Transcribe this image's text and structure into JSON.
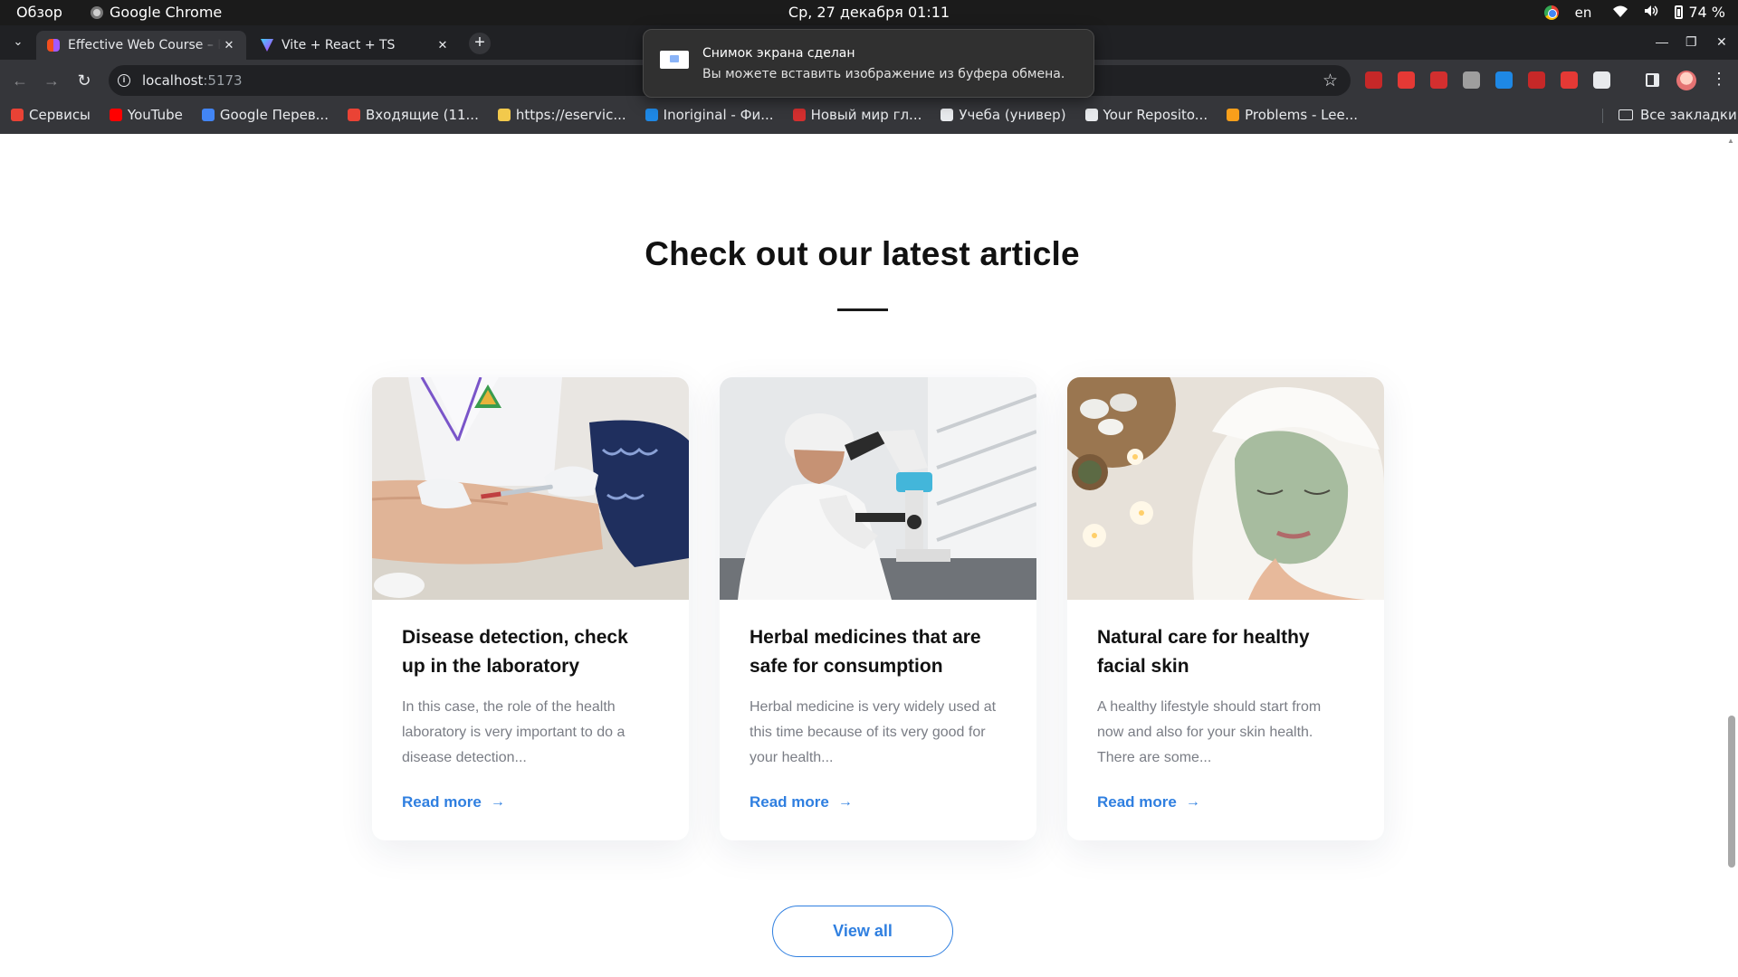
{
  "system_bar": {
    "overview": "Обзор",
    "app_name": "Google Chrome",
    "clock": "Ср, 27 декабря  01:11",
    "keyboard_layout": "en",
    "battery": "74 %"
  },
  "browser": {
    "tabs": [
      {
        "title": "Effective Web Course – F",
        "favicon": "figma-icon",
        "active": true
      },
      {
        "title": "Vite + React + TS",
        "favicon": "vite-icon",
        "active": false
      }
    ],
    "url_host": "localhost",
    "url_port": ":5173",
    "bookmarks": [
      {
        "label": "Сервисы",
        "icon": "apps-grid-icon",
        "color": "#e94235"
      },
      {
        "label": "YouTube",
        "icon": "youtube-icon",
        "color": "#ff0000"
      },
      {
        "label": "Google Перев...",
        "icon": "google-translate-icon",
        "color": "#4285f4"
      },
      {
        "label": "Входящие (11...",
        "icon": "gmail-icon",
        "color": "#ea4335"
      },
      {
        "label": "https://eservic...",
        "icon": "bookmark-site-icon",
        "color": "#f2c94c"
      },
      {
        "label": "Inoriginal - Фи...",
        "icon": "play-circle-icon",
        "color": "#1e88e5"
      },
      {
        "label": "Новый мир гл...",
        "icon": "bookmark-site-icon",
        "color": "#d32f2f"
      },
      {
        "label": "Учеба (универ)",
        "icon": "notion-icon",
        "color": "#e8eaed"
      },
      {
        "label": "Your Reposito...",
        "icon": "github-icon",
        "color": "#e8eaed"
      },
      {
        "label": "Problems - Lee...",
        "icon": "leetcode-icon",
        "color": "#f89f1b"
      }
    ],
    "all_bookmarks": "Все закладки",
    "extension_colors": [
      "#c62828",
      "#e53935",
      "#d32f2f",
      "#9e9e9e",
      "#1e88e5",
      "#c62828",
      "#e53935",
      "#e8eaed"
    ]
  },
  "notification": {
    "title": "Снимок экрана сделан",
    "body": "Вы можете вставить изображение из буфера обмена."
  },
  "page": {
    "section_title": "Check out our latest article",
    "articles": [
      {
        "title": "Disease detection, check up in the laboratory",
        "excerpt": "In this case, the role of the health laboratory is very important to do a disease detection...",
        "link": "Read more",
        "image": "laboratory-blood-test-photo"
      },
      {
        "title": "Herbal medicines that are safe for consumption",
        "excerpt": "Herbal medicine is very widely used at this time because of its very good for your health...",
        "link": "Read more",
        "image": "scientist-microscope-photo"
      },
      {
        "title": "Natural care for healthy facial skin",
        "excerpt": "A healthy lifestyle should start from now and also for your skin health. There are some...",
        "link": "Read more",
        "image": "facial-mask-spa-photo"
      }
    ],
    "view_all": "View all",
    "accent_color": "#2f7fe0"
  }
}
